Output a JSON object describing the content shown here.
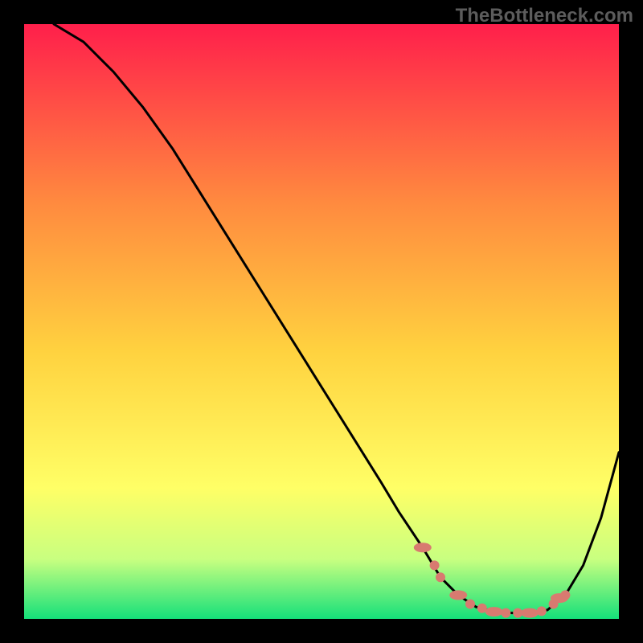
{
  "watermark": "TheBottleneck.com",
  "colors": {
    "gradient_top": "#ff1f4b",
    "gradient_mid1": "#ff8a3f",
    "gradient_mid2": "#ffd23f",
    "gradient_mid3": "#ffff66",
    "gradient_mid4": "#c8ff80",
    "gradient_bottom": "#15e07a",
    "curve": "#000000",
    "marker": "#d87a70"
  },
  "chart_data": {
    "type": "line",
    "title": "",
    "xlabel": "",
    "ylabel": "",
    "xlim": [
      0,
      100
    ],
    "ylim": [
      0,
      100
    ],
    "series": [
      {
        "name": "curve",
        "x": [
          5,
          10,
          15,
          20,
          25,
          30,
          35,
          40,
          45,
          50,
          55,
          60,
          63,
          67,
          70,
          73,
          76,
          79,
          82,
          85,
          88,
          91,
          94,
          97,
          100
        ],
        "y": [
          100,
          97,
          92,
          86,
          79,
          71,
          63,
          55,
          47,
          39,
          31,
          23,
          18,
          12,
          7,
          4,
          2,
          1.2,
          1,
          1,
          1.5,
          4,
          9,
          17,
          28
        ]
      }
    ],
    "markers": {
      "name": "highlight-cluster",
      "points": [
        {
          "x": 67,
          "y": 12
        },
        {
          "x": 69,
          "y": 9
        },
        {
          "x": 70,
          "y": 7
        },
        {
          "x": 73,
          "y": 4
        },
        {
          "x": 75,
          "y": 2.5
        },
        {
          "x": 77,
          "y": 1.8
        },
        {
          "x": 79,
          "y": 1.2
        },
        {
          "x": 81,
          "y": 1
        },
        {
          "x": 83,
          "y": 1
        },
        {
          "x": 85,
          "y": 1
        },
        {
          "x": 87,
          "y": 1.3
        },
        {
          "x": 89,
          "y": 2.5
        },
        {
          "x": 90,
          "y": 3.5
        },
        {
          "x": 91,
          "y": 4
        }
      ]
    }
  }
}
